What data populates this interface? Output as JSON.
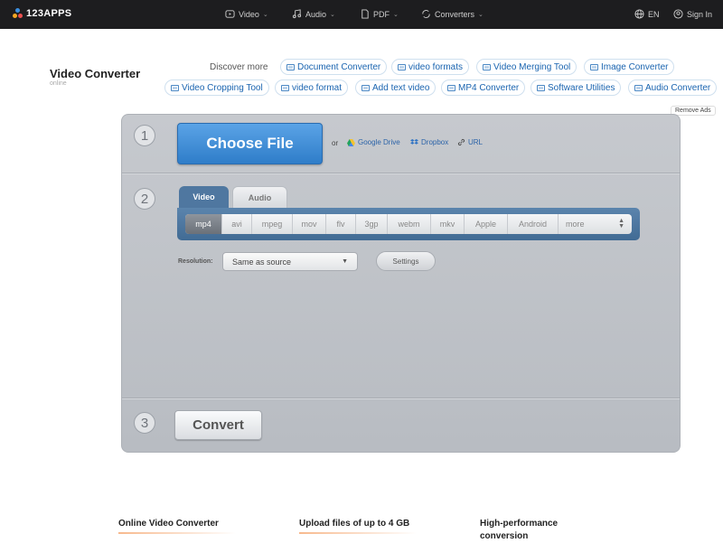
{
  "nav": {
    "logo": "123APPS",
    "items": [
      {
        "label": "Video",
        "icon": "video-icon"
      },
      {
        "label": "Audio",
        "icon": "music-icon"
      },
      {
        "label": "PDF",
        "icon": "pdf-icon"
      },
      {
        "label": "Converters",
        "icon": "converters-icon"
      }
    ],
    "language": "EN",
    "sign_in": "Sign In"
  },
  "header": {
    "title": "Video Converter",
    "subtitle": "online",
    "discover_label": "Discover more",
    "remove_ads": "Remove Ads",
    "chips": [
      "Document Converter",
      "video formats",
      "Video Merging Tool",
      "Image Converter",
      "Video Cropping Tool",
      "video format",
      "Add text video",
      "MP4 Converter",
      "Software Utilities",
      "Audio Converter"
    ]
  },
  "converter": {
    "steps": [
      "1",
      "2",
      "3"
    ],
    "choose_file": "Choose File",
    "or": "or",
    "sources": [
      "Google Drive",
      "Dropbox",
      "URL"
    ],
    "tabs": [
      "Video",
      "Audio"
    ],
    "active_tab": "Video",
    "formats": [
      "mp4",
      "avi",
      "mpeg",
      "mov",
      "flv",
      "3gp",
      "webm",
      "mkv",
      "Apple",
      "Android",
      "more"
    ],
    "active_format": "mp4",
    "resolution_label": "Resolution:",
    "resolution_value": "Same as source",
    "settings": "Settings",
    "convert": "Convert"
  },
  "features": [
    "Online Video Converter",
    "Upload files of up to 4 GB",
    "High-performance conversion"
  ],
  "colors": {
    "nav_bg": "#1d1d1f",
    "choose_button": "#3f8ad3",
    "link": "#1a64b0",
    "panel": "#c2c5ca",
    "format_bar": "#4f77a0"
  }
}
